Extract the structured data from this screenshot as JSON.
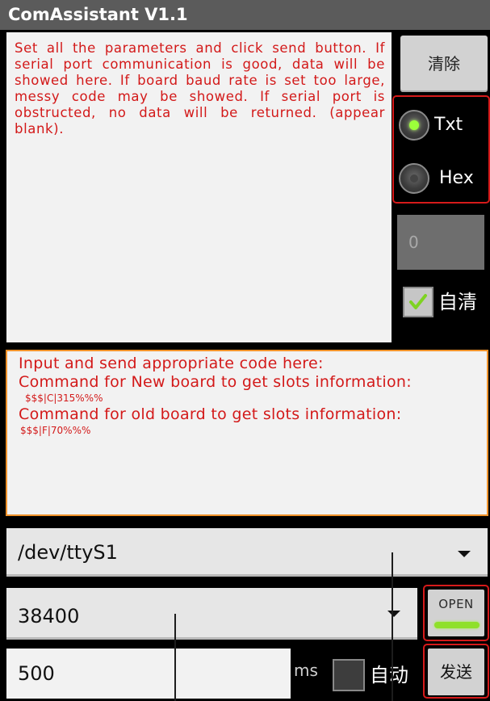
{
  "app": {
    "title": "ComAssistant V1.1"
  },
  "receive_area": {
    "text": "Set all the parameters and click send button. If serial port communication is good, data will be showed here. If board baud rate is set too large, messy code may be showed. If serial port is obstructed, no data will be returned. (appear blank)."
  },
  "controls": {
    "clear_label": "清除",
    "radio_txt_label": "Txt",
    "radio_hex_label": "Hex",
    "radio_selected": "Txt",
    "counter_value": "0",
    "auto_clear_label": "自清",
    "auto_clear_checked": true
  },
  "send_area": {
    "line1": "Input and send appropriate code here:",
    "line2": "Command for New board to get slots information:",
    "line3": "$$$|C|315%%%",
    "line4": "Command for old board to get slots information:",
    "line5": "$$$|F|70%%%"
  },
  "port": {
    "selected": "/dev/ttyS1"
  },
  "baud": {
    "selected": "38400"
  },
  "open_button": {
    "label": "OPEN"
  },
  "interval": {
    "value": "500",
    "unit": "ms"
  },
  "auto_send": {
    "label": "自动",
    "checked": false
  },
  "send_button": {
    "label": "发送"
  },
  "colors": {
    "annotation_red": "#d31919",
    "highlight_orange": "#f0922a",
    "open_indicator": "#8fe02a"
  }
}
